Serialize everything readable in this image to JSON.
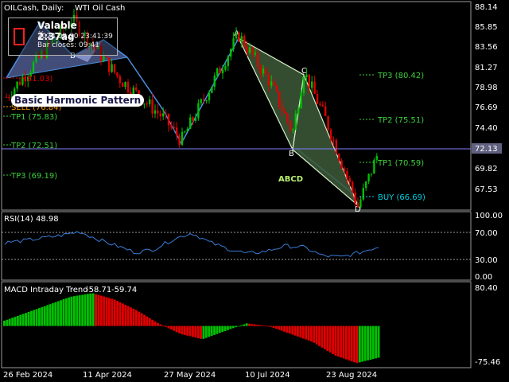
{
  "header": {
    "symbol_label": "OILCash, Daily:",
    "instrument": "WTI Oil Cash"
  },
  "info_box": {
    "title": "Valable 2:37ag",
    "time": "2024.09.20 23:41:39",
    "bar_closes": "Bar closes: 09:41",
    "icon": "alert-square-icon",
    "icon_color": "#ff2020"
  },
  "pattern": {
    "name": "Basic Harmonic Pattern",
    "points": {
      "A": "A",
      "B": "B",
      "C": "C",
      "D": "D"
    },
    "abcd_label": "ABCD",
    "left_points": {
      "X": "X",
      "B": "B"
    }
  },
  "left_levels": {
    "p1": "(81.03)",
    "sell": "SELL (76.84)",
    "tp1": "TP1 (75.83)",
    "tp2": "TP2 (72.51)",
    "tp3": "TP3 (69.19)"
  },
  "right_levels": {
    "tp3": "TP3 (80.42)",
    "tp2": "TP2 (75.51)",
    "tp1": "TP1 (70.59)",
    "buy": "BUY (66.69)"
  },
  "price_axis": {
    "ticks": [
      "88.14",
      "85.85",
      "83.56",
      "81.27",
      "78.98",
      "76.69",
      "74.40",
      "72.13",
      "69.82",
      "67.53"
    ],
    "current_price": "72.13"
  },
  "rsi": {
    "title": "RSI(14) 48.98",
    "axis": [
      "100.00",
      "70.00",
      "30.00",
      "0.00"
    ]
  },
  "macd": {
    "title": "MACD Intraday Trend",
    "value1": "-58.71",
    "value2": "-59.74",
    "axis": [
      "80.40",
      "-75.46"
    ]
  },
  "time_axis": {
    "labels": [
      "26 Feb 2024",
      "11 Apr 2024",
      "27 May 2024",
      "10 Jul 2024",
      "23 Aug 2024"
    ]
  },
  "colors": {
    "bull": "#00c000",
    "bear": "#e00000",
    "pattern_fill": "#3d5a3a",
    "pattern_line": "#d8f0c8",
    "harmonic_line": "#4a90e0",
    "rsi_line": "#3a7bd5",
    "level_green": "#3cd03c",
    "buy_cyan": "#00d0e0",
    "sell_orange": "#ff9900",
    "price_line": "#8080ff"
  },
  "chart_data": [
    {
      "type": "line",
      "title": "OILCash, Daily: WTI Oil Cash",
      "ylim": [
        66.5,
        88.6
      ],
      "x": [
        "26 Feb 2024",
        "11 Apr 2024",
        "27 May 2024",
        "10 Jul 2024",
        "23 Aug 2024"
      ],
      "series": [
        {
          "name": "",
          "values": [
            78.5,
            86.9,
            76.3,
            83.5,
            75.2,
            72.1
          ]
        }
      ],
      "levels": [
        80.42,
        75.51,
        70.59,
        66.69,
        81.03,
        76.84,
        75.83,
        72.51,
        69.19
      ],
      "current_price": 72.13
    },
    {
      "type": "line",
      "title": "RSI(14) 48.98",
      "ylim": [
        0,
        100
      ],
      "series": [
        {
          "name": "",
          "values": [
            55,
            58,
            62,
            66,
            72,
            60,
            50,
            40,
            45,
            60,
            70,
            55,
            45,
            38,
            42,
            50,
            48,
            35,
            33,
            40,
            48.98
          ]
        }
      ]
    },
    {
      "type": "bar",
      "title": "MACD Intraday Trend",
      "ylim": [
        -75.46,
        80.4
      ],
      "series": [
        {
          "name": "",
          "values": [
            10,
            25,
            40,
            55,
            62,
            50,
            30,
            5,
            -15,
            -25,
            -10,
            5,
            0,
            -15,
            -30,
            -55,
            -70,
            -59.74
          ]
        }
      ]
    }
  ]
}
